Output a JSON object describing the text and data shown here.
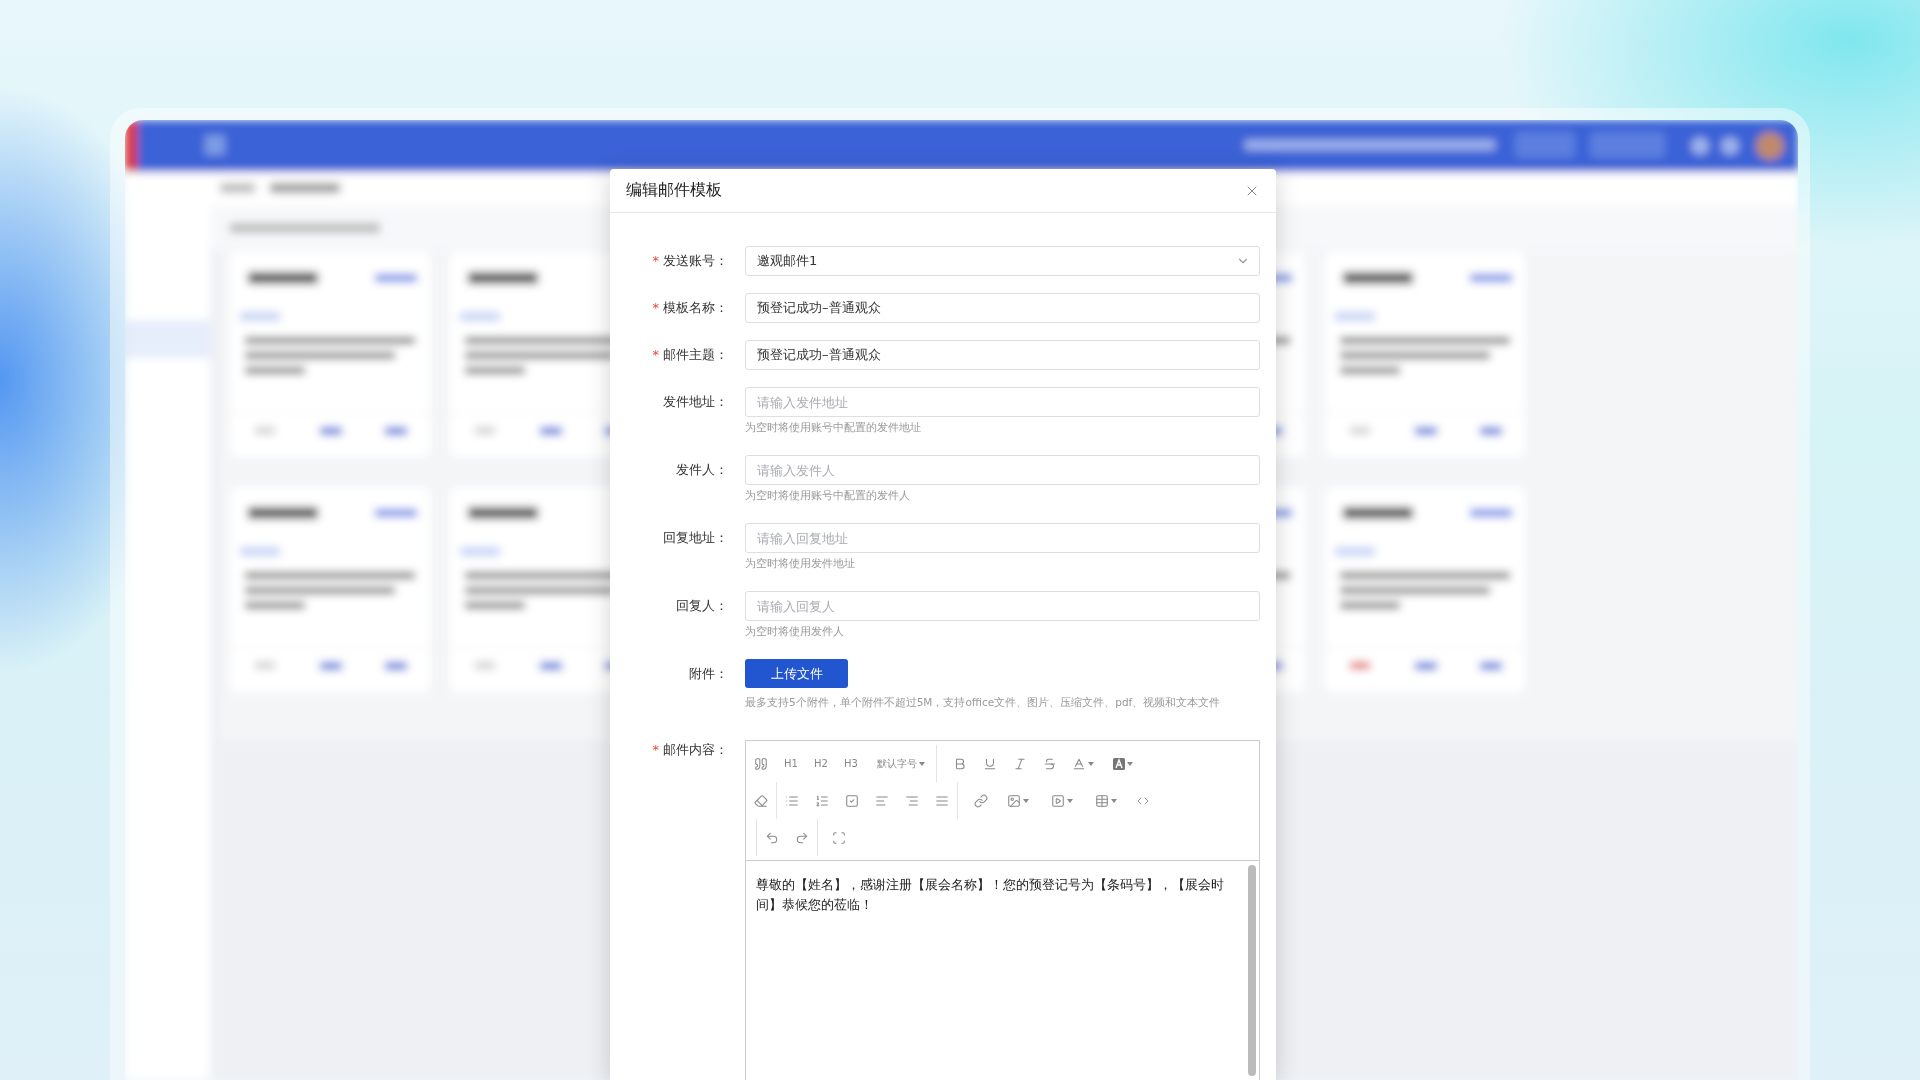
{
  "dialog": {
    "title": "编辑邮件模板",
    "required_mark": "*",
    "fields": [
      {
        "kind": "select",
        "label": "发送账号：",
        "required": true,
        "value": "邀观邮件1"
      },
      {
        "kind": "input",
        "label": "模板名称：",
        "required": true,
        "value": "预登记成功–普通观众"
      },
      {
        "kind": "input",
        "label": "邮件主题：",
        "required": true,
        "value": "预登记成功–普通观众"
      },
      {
        "kind": "input",
        "label": "发件地址：",
        "required": false,
        "placeholder": "请输入发件地址",
        "hint": "为空时将使用账号中配置的发件地址"
      },
      {
        "kind": "input",
        "label": "发件人：",
        "required": false,
        "placeholder": "请输入发件人",
        "hint": "为空时将使用账号中配置的发件人"
      },
      {
        "kind": "input",
        "label": "回复地址：",
        "required": false,
        "placeholder": "请输入回复地址",
        "hint": "为空时将使用发件地址"
      },
      {
        "kind": "input",
        "label": "回复人：",
        "required": false,
        "placeholder": "请输入回复人",
        "hint": "为空时将使用发件人"
      }
    ],
    "attachment": {
      "label": "附件：",
      "button": "上传文件",
      "hint": "最多支持5个附件，单个附件不超过5M，支持office文件、图片、压缩文件、pdf、视频和文本文件"
    },
    "editor": {
      "label": "邮件内容：",
      "required": true,
      "heading_buttons": [
        "H1",
        "H2",
        "H3"
      ],
      "font_size": "默认字号",
      "content": "尊敬的【姓名】，感谢注册【展会名称】！您的预登记号为【条码号】，【展会时间】恭候您的莅临！"
    }
  }
}
